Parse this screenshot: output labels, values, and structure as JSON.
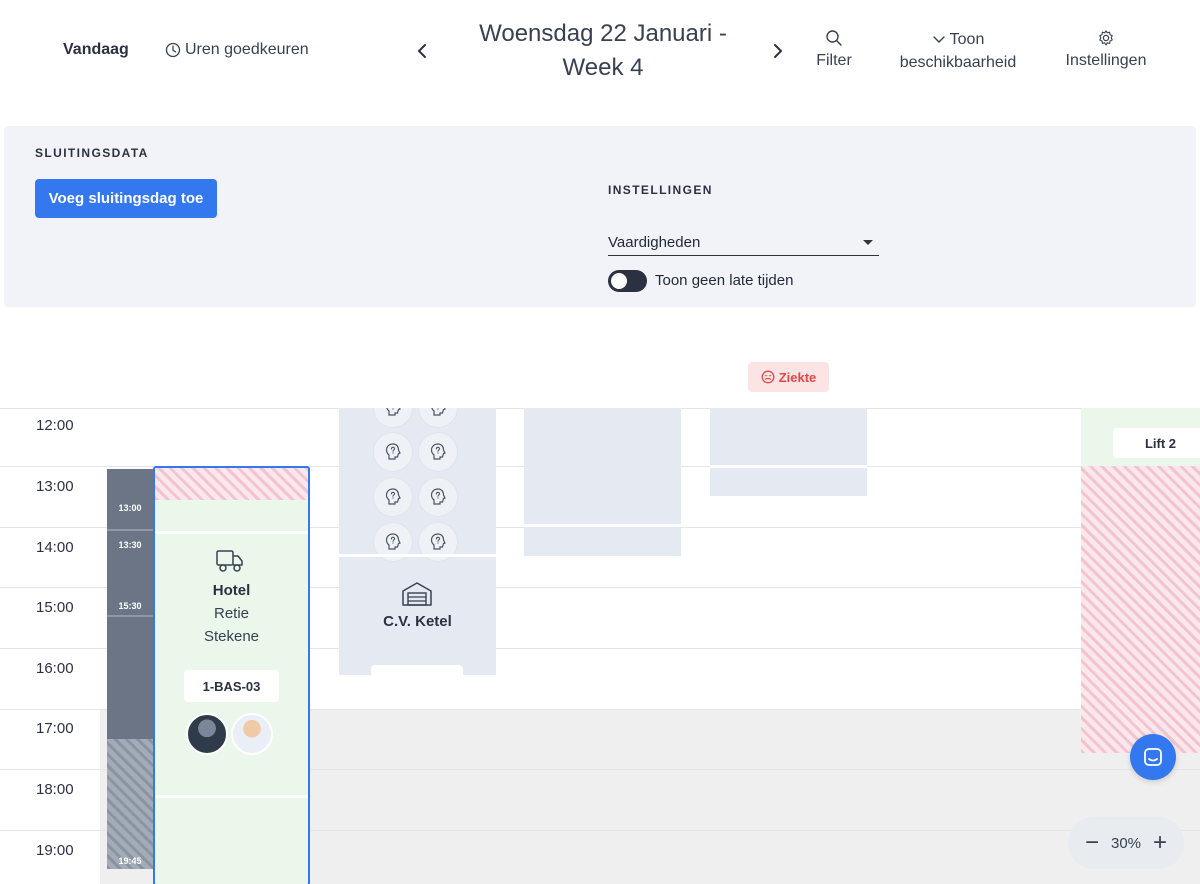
{
  "header": {
    "today_label": "Vandaag",
    "approve_label": "Uren goedkeuren",
    "date_title": "Woensdag 22 Januari - Week 4",
    "filter_label": "Filter",
    "availability_label_1": "Toon",
    "availability_label_2": "beschikbaarheid",
    "settings_label": "Instellingen"
  },
  "panel": {
    "closing_heading": "SLUITINGSDATA",
    "add_closing_label": "Voeg sluitingsdag toe",
    "settings_heading": "INSTELLINGEN",
    "skills_select_value": "Vaardigheden",
    "late_times_label": "Toon geen late tijden",
    "late_times_enabled": false
  },
  "sick_badge": "Ziekte",
  "time_slots": [
    "12:00",
    "13:00",
    "14:00",
    "15:00",
    "16:00",
    "17:00",
    "18:00",
    "19:00"
  ],
  "bar_times": [
    "13:00",
    "13:30",
    "15:30",
    "19:45"
  ],
  "job": {
    "title": "Hotel",
    "location_1": "Retie",
    "location_2": "Stekene",
    "plate": "1-BAS-03"
  },
  "cv_label": "C.V. Ketel",
  "lift_label": "Lift 2",
  "zoom": {
    "value": "30%"
  },
  "colors": {
    "accent": "#3478f0",
    "sick": "#e04848",
    "job_bg": "#eaf7ea",
    "column_bg": "#e5eaf2"
  }
}
